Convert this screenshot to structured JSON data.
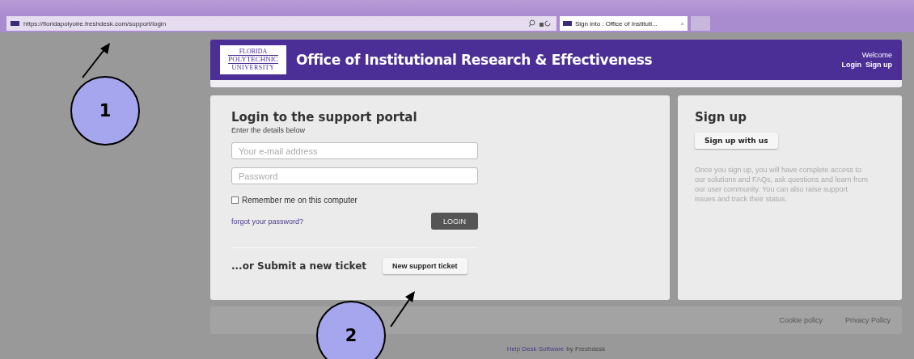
{
  "browser": {
    "url": "https://floridapolyoire.freshdesk.com/support/login",
    "tab": {
      "title": "Sign into : Office of Instituti...",
      "close": "×",
      "selected": true
    }
  },
  "header": {
    "logo": [
      "FLORIDA",
      "POLYTECHNIC",
      "UNIVERSITY"
    ],
    "title": "Office of Institutional Research & Effectiveness",
    "welcome": "Welcome",
    "links": [
      "Login",
      "Sign up"
    ]
  },
  "login": {
    "title": "Login to the support portal",
    "subtitle": "Enter the details below",
    "email": {
      "placeholder": "Your e-mail address"
    },
    "password": {
      "placeholder": "Password"
    },
    "remember": {
      "label": "Remember me on this computer",
      "checked": false
    },
    "forgot": "forgot your password?",
    "button": "LOGIN",
    "ticket_label": "...or Submit a new ticket",
    "ticket_button": "New support ticket"
  },
  "signup": {
    "title": "Sign up",
    "button": "Sign up with us",
    "text": "Once you sign up, you will have complete access to our solutions and FAQs, ask questions and learn from our user community. You can also raise support issues and track their status."
  },
  "footer": {
    "links": [
      "Cookie policy",
      "Privacy Policy"
    ],
    "credit_link": "Help Desk Software",
    "credit_rest": "by Freshdesk"
  },
  "callouts": [
    "1",
    "2"
  ]
}
